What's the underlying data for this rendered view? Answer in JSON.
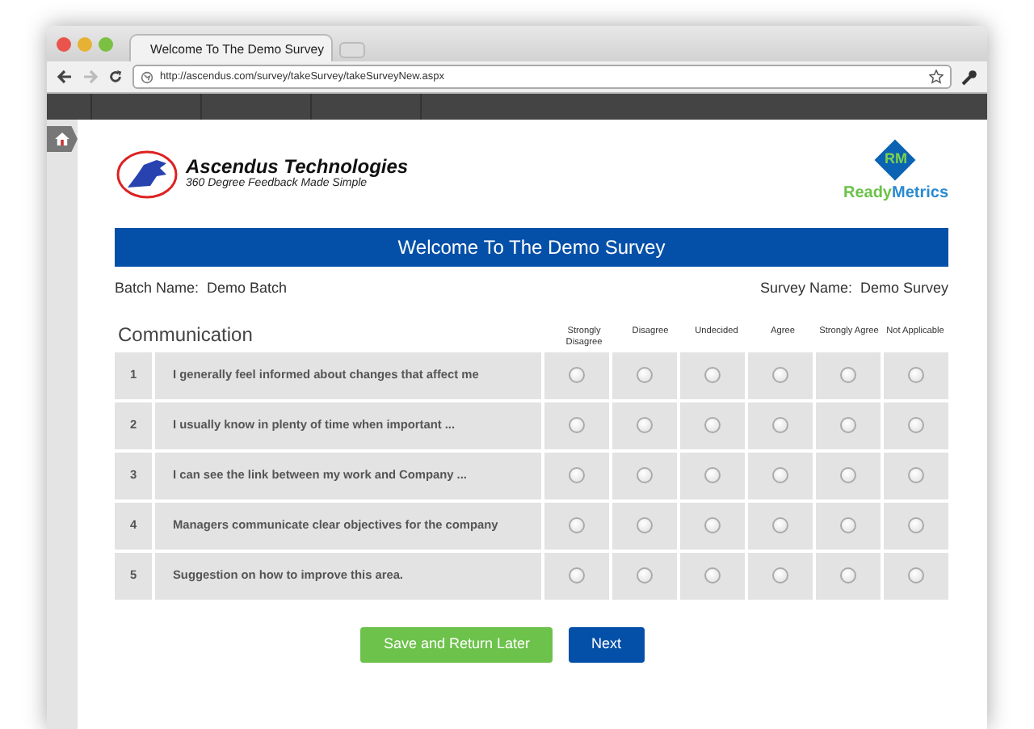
{
  "browser": {
    "tab_title": "Welcome To The Demo Survey",
    "url": "http://ascendus.com/survey/takeSurvey/takeSurveyNew.aspx"
  },
  "company": {
    "name": "Ascendus Technologies",
    "tagline": "360 Degree Feedback Made Simple"
  },
  "partner_logo": {
    "monogram": "RM",
    "word_1": "Ready",
    "word_2": "Metrics"
  },
  "banner": "Welcome To The Demo Survey",
  "batch": {
    "label": "Batch Name:",
    "value": "Demo Batch"
  },
  "survey": {
    "label": "Survey Name:",
    "value": "Demo Survey"
  },
  "section": "Communication",
  "columns": [
    "Strongly Disagree",
    "Disagree",
    "Undecided",
    "Agree",
    "Strongly Agree",
    "Not Applicable"
  ],
  "questions": [
    {
      "number": "1",
      "text": "I generally feel informed about changes that affect me",
      "choices": [
        {
          "selected": false
        },
        {
          "selected": false
        },
        {
          "selected": false
        },
        {
          "selected": false
        },
        {
          "selected": false
        },
        {
          "selected": false
        }
      ]
    },
    {
      "number": "2",
      "text": "I usually know in plenty of time when important ...",
      "choices": [
        {
          "selected": false
        },
        {
          "selected": false
        },
        {
          "selected": false
        },
        {
          "selected": false
        },
        {
          "selected": false
        },
        {
          "selected": false
        }
      ]
    },
    {
      "number": "3",
      "text": "I can see the link between my work and Company ...",
      "choices": [
        {
          "selected": false
        },
        {
          "selected": false
        },
        {
          "selected": false
        },
        {
          "selected": false
        },
        {
          "selected": false
        },
        {
          "selected": false
        }
      ]
    },
    {
      "number": "4",
      "text": "Managers communicate clear objectives for the company",
      "choices": [
        {
          "selected": false
        },
        {
          "selected": false
        },
        {
          "selected": false
        },
        {
          "selected": false
        },
        {
          "selected": false
        },
        {
          "selected": false
        }
      ]
    },
    {
      "number": "5",
      "text": "Suggestion on how to improve this area.",
      "choices": [
        {
          "selected": false
        },
        {
          "selected": false
        },
        {
          "selected": false
        },
        {
          "selected": false
        },
        {
          "selected": false
        },
        {
          "selected": false
        }
      ]
    }
  ],
  "buttons": [
    {
      "label": "Save and Return Later",
      "kind": "secondary"
    },
    {
      "label": "Next",
      "kind": "primary"
    }
  ]
}
